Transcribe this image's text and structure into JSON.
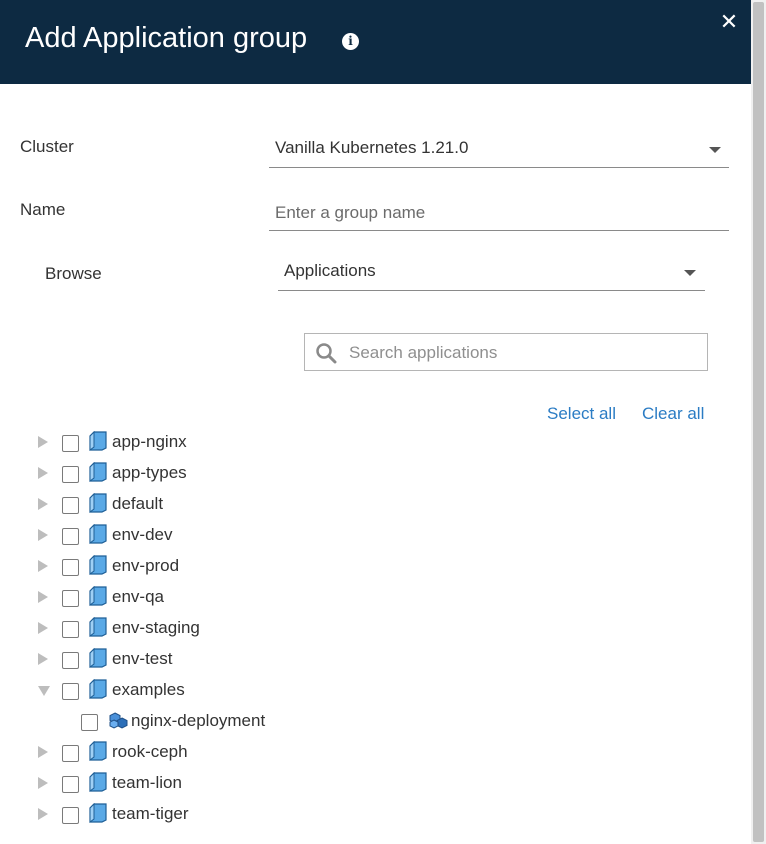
{
  "header": {
    "title": "Add Application group",
    "colors": {
      "background": "#0d2a42",
      "text": "#ffffff"
    }
  },
  "form": {
    "cluster_label": "Cluster",
    "cluster_value": "Vanilla Kubernetes 1.21.0",
    "name_label": "Name",
    "name_placeholder": "Enter a group name",
    "name_value": "",
    "browse_label": "Browse",
    "browse_value": "Applications"
  },
  "search": {
    "placeholder": "Search applications",
    "value": ""
  },
  "actions": {
    "select_all": "Select all",
    "clear_all": "Clear all",
    "link_color": "#2b7cc4"
  },
  "tree": [
    {
      "label": "app-nginx",
      "kind": "namespace",
      "expanded": false,
      "checked": false,
      "level": 0
    },
    {
      "label": "app-types",
      "kind": "namespace",
      "expanded": false,
      "checked": false,
      "level": 0
    },
    {
      "label": "default",
      "kind": "namespace",
      "expanded": false,
      "checked": false,
      "level": 0
    },
    {
      "label": "env-dev",
      "kind": "namespace",
      "expanded": false,
      "checked": false,
      "level": 0
    },
    {
      "label": "env-prod",
      "kind": "namespace",
      "expanded": false,
      "checked": false,
      "level": 0
    },
    {
      "label": "env-qa",
      "kind": "namespace",
      "expanded": false,
      "checked": false,
      "level": 0
    },
    {
      "label": "env-staging",
      "kind": "namespace",
      "expanded": false,
      "checked": false,
      "level": 0
    },
    {
      "label": "env-test",
      "kind": "namespace",
      "expanded": false,
      "checked": false,
      "level": 0
    },
    {
      "label": "examples",
      "kind": "namespace",
      "expanded": true,
      "checked": false,
      "level": 0
    },
    {
      "label": "nginx-deployment",
      "kind": "deployment",
      "expanded": false,
      "checked": false,
      "level": 1
    },
    {
      "label": "rook-ceph",
      "kind": "namespace",
      "expanded": false,
      "checked": false,
      "level": 0
    },
    {
      "label": "team-lion",
      "kind": "namespace",
      "expanded": false,
      "checked": false,
      "level": 0
    },
    {
      "label": "team-tiger",
      "kind": "namespace",
      "expanded": false,
      "checked": false,
      "level": 0
    }
  ]
}
